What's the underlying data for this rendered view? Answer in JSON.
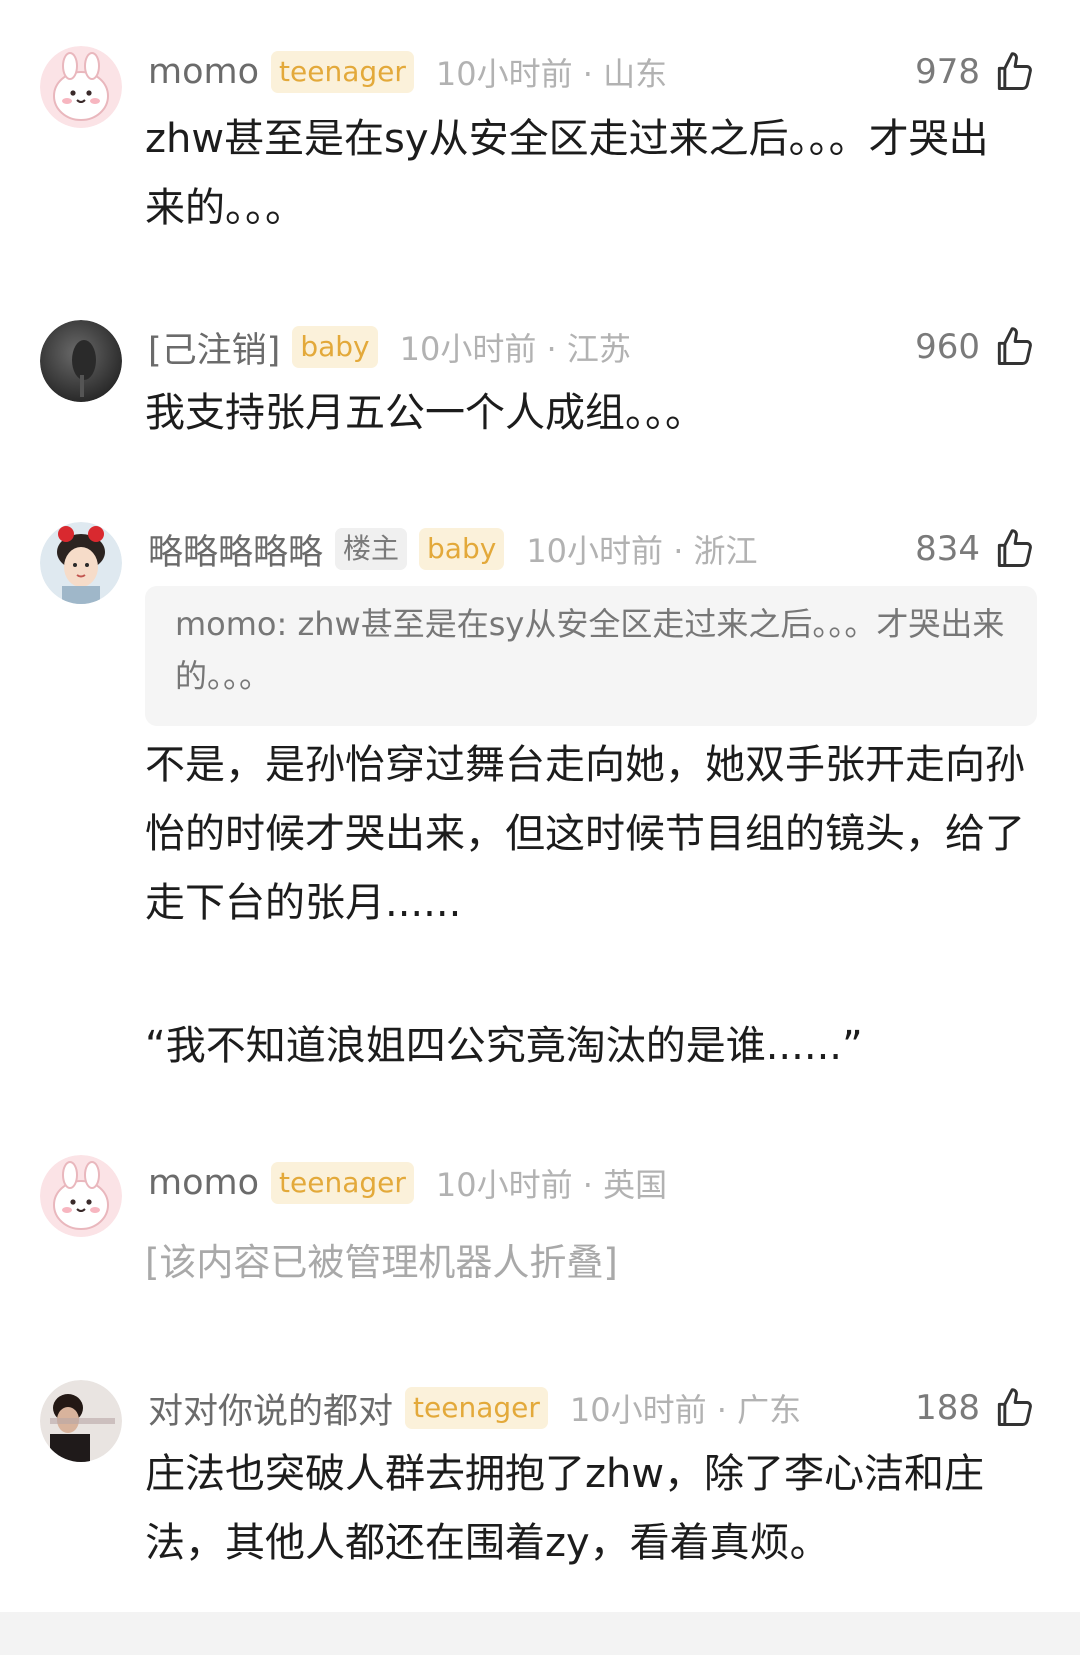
{
  "comments": [
    {
      "username": "momo",
      "badges": [
        "teenager"
      ],
      "time_location": "10小时前 · 山东",
      "likes": "978",
      "text": "zhw甚至是在sy从安全区走过来之后。。。才哭出来的。。。",
      "avatar": "pink-bunny-avatar"
    },
    {
      "username": "[己注销]",
      "badges": [
        "baby"
      ],
      "time_location": "10小时前 · 江苏",
      "likes": "960",
      "text": "我支持张月五公一个人成组。。。",
      "avatar": "dark-photo-avatar"
    },
    {
      "username": "略略略略略",
      "op_badge": "楼主",
      "badges": [
        "baby"
      ],
      "time_location": "10小时前 · 浙江",
      "likes": "834",
      "quote": "momo: zhw甚至是在sy从安全区走过来之后。。。才哭出来的。。。",
      "text": "不是，是孙怡穿过舞台走向她，她双手张开走向孙怡的时候才哭出来，但这时候节目组的镜头，给了走下台的张月......",
      "text2": "“我不知道浪姐四公究竟淘汰的是谁......”",
      "avatar": "girl-portrait-avatar"
    },
    {
      "username": "momo",
      "badges": [
        "teenager"
      ],
      "time_location": "10小时前 · 英国",
      "folded_text": "[该内容已被管理机器人折叠]",
      "avatar": "pink-bunny-avatar"
    },
    {
      "username": "对对你说的都对",
      "badges": [
        "teenager"
      ],
      "time_location": "10小时前 · 广东",
      "likes": "188",
      "text": "庄法也突破人群去拥抱了zhw，除了李心洁和庄法，其他人都还在围着zy，看着真烦。",
      "avatar": "man-photo-avatar"
    }
  ],
  "colors": {
    "badge_bg": "#fbf1da",
    "badge_text": "#e3a93a",
    "meta_gray": "#b2b2b2",
    "text": "#1c1c1c"
  },
  "icons": [
    "thumbs-up-icon"
  ]
}
